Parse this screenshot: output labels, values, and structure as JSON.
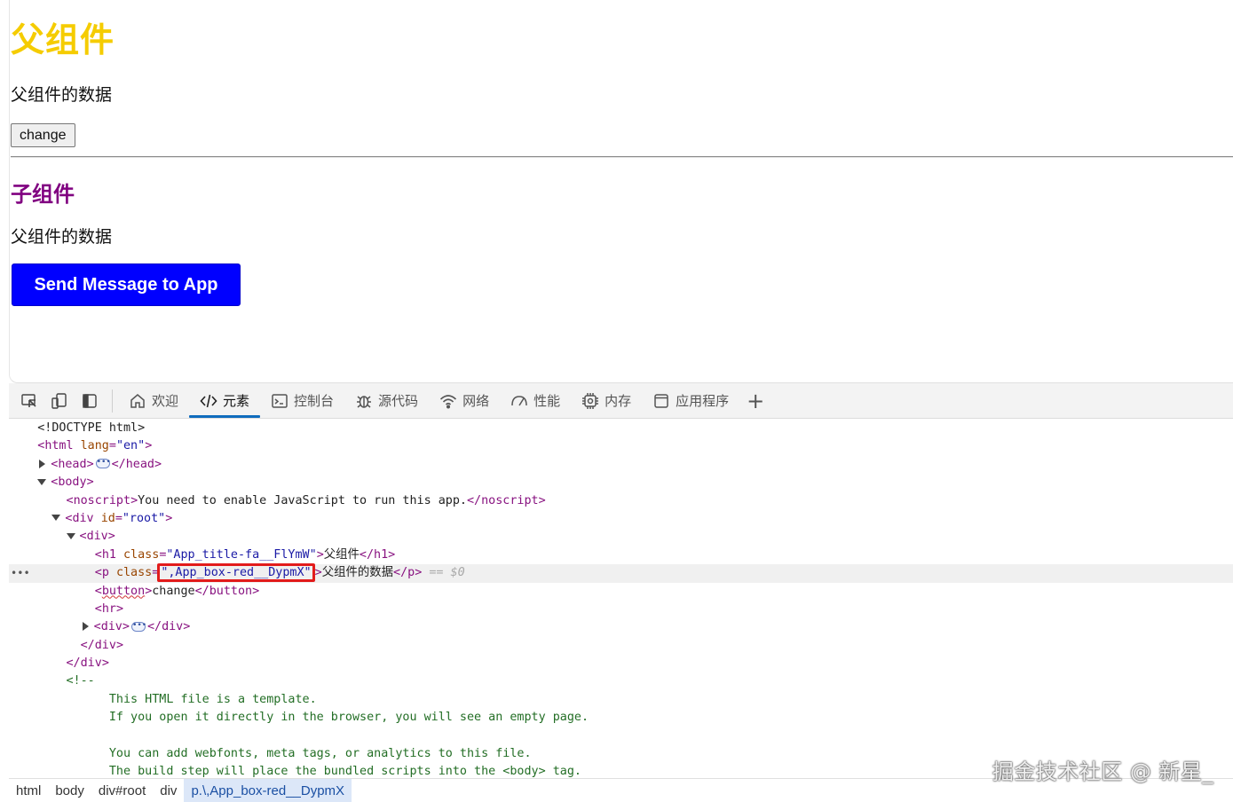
{
  "page": {
    "parent_title": "父组件",
    "parent_text": "父组件的数据",
    "change_button": "change",
    "child_title": "子组件",
    "child_text": "父组件的数据",
    "send_button": "Send Message to App",
    "title_color": "#f5cc00",
    "child_title_color": "#800080",
    "send_button_color": "#0000ff"
  },
  "devtools": {
    "tabs": [
      {
        "label": "欢迎",
        "icon": "home-icon"
      },
      {
        "label": "元素",
        "icon": "code-icon",
        "active": true
      },
      {
        "label": "控制台",
        "icon": "console-icon"
      },
      {
        "label": "源代码",
        "icon": "bug-icon"
      },
      {
        "label": "网络",
        "icon": "wifi-icon"
      },
      {
        "label": "性能",
        "icon": "gauge-icon"
      },
      {
        "label": "内存",
        "icon": "chip-icon"
      },
      {
        "label": "应用程序",
        "icon": "app-window-icon"
      }
    ],
    "tree": {
      "doctype": "<!DOCTYPE html>",
      "html_open": "html",
      "html_lang_attr": "lang",
      "html_lang_val": "\"en\"",
      "head": "head",
      "body": "body",
      "noscript": "noscript",
      "noscript_text": "You need to enable JavaScript to run this app.",
      "div_root_attr": "id",
      "div_root_val": "\"root\"",
      "div": "div",
      "h1": "h1",
      "h1_class_val": "\"App_title-fa__FlYmW\"",
      "h1_text": "父组件",
      "class_attr": "class",
      "p": "p",
      "p_class_val": "\",App_box-red__DypmX\"",
      "p_text": "父组件的数据",
      "dollar0": "== $0",
      "button": "button",
      "button_text": "change",
      "hr": "hr",
      "comment_open": "<!--",
      "comment_lines": [
        "This HTML file is a template.",
        "If you open it directly in the browser, you will see an empty page.",
        "",
        "You can add webfonts, meta tags, or analytics to this file.",
        "The build step will place the bundled scripts into the <body> tag."
      ]
    },
    "breadcrumbs": [
      "html",
      "body",
      "div#root",
      "div",
      "p.\\,App_box-red__DypmX"
    ]
  },
  "watermark": "掘金技术社区 @ 新星_"
}
